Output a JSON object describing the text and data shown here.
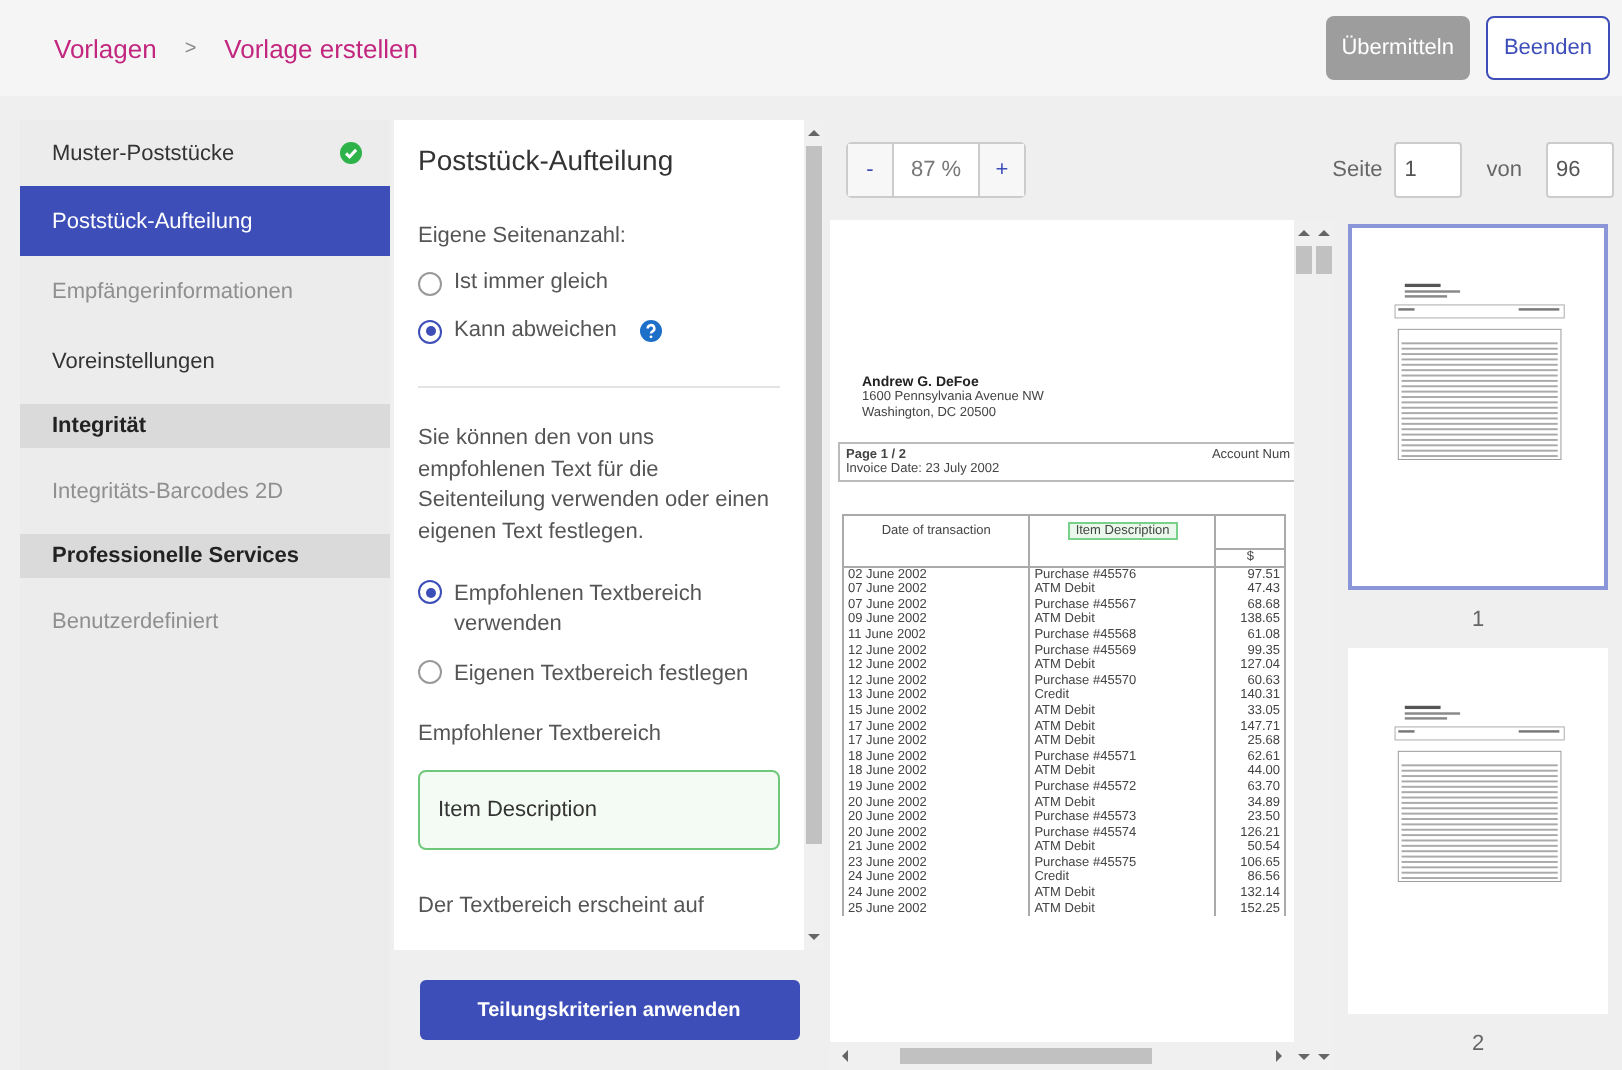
{
  "header": {
    "breadcrumb": [
      "Vorlagen",
      ">",
      "Vorlage erstellen"
    ],
    "buttons": [
      {
        "label": "Übermitteln",
        "kind": "primary",
        "disabled": true
      },
      {
        "label": "Beenden",
        "kind": "outline",
        "disabled": false
      }
    ]
  },
  "sidebar": {
    "items": [
      {
        "label": "Muster-Poststücke",
        "kind": "step",
        "selected": false,
        "disabled": false,
        "done": true
      },
      {
        "label": "Poststück-Aufteilung",
        "kind": "step",
        "selected": true,
        "disabled": false,
        "done": false
      },
      {
        "label": "Empfängerinformationen",
        "kind": "step",
        "selected": false,
        "disabled": true,
        "done": false
      },
      {
        "label": "Voreinstellungen",
        "kind": "step",
        "selected": false,
        "disabled": false,
        "done": false
      },
      {
        "label": "Integrität",
        "kind": "section"
      },
      {
        "label": "Integritäts-Barcodes 2D",
        "kind": "step",
        "selected": false,
        "disabled": true,
        "done": false
      },
      {
        "label": "Professionelle Services",
        "kind": "section"
      },
      {
        "label": "Benutzerdefiniert",
        "kind": "step",
        "selected": false,
        "disabled": true,
        "done": false
      }
    ]
  },
  "settings": {
    "title": "Poststück-Aufteilung",
    "page_count": {
      "label": "Eigene Seitenanzahl:",
      "options": [
        {
          "label": "Ist immer gleich",
          "selected": false,
          "help": false
        },
        {
          "label": "Kann abweichen",
          "selected": true,
          "help": true
        }
      ]
    },
    "description": "Sie können den von uns empfohlenen Text für die Seitenteilung verwenden oder einen eigenen Text festlegen.",
    "text_area": {
      "options": [
        {
          "label": "Empfohlenen Textbereich verwenden",
          "selected": true
        },
        {
          "label": "Eigenen Textbereich festlegen",
          "selected": false
        }
      ]
    },
    "recommended": {
      "label": "Empfohlener Textbereich",
      "value": "Item Description"
    },
    "note": "Der Textbereich erscheint auf",
    "apply_button": "Teilungskriterien anwenden"
  },
  "preview": {
    "zoom": {
      "minus": "-",
      "value": "87 %",
      "plus": "+"
    },
    "document": {
      "name": "Andrew G. DeFoe",
      "address": [
        "1600 Pennsylvania Avenue NW",
        "Washington, DC 20500"
      ],
      "page": "Page 1 / 2",
      "invoice_date": "Invoice Date: 23 July 2002",
      "account": "Account Num",
      "columns": [
        "Date of transaction",
        "Item Description"
      ],
      "subcolumn": "$",
      "rows": [
        [
          "02 June 2002",
          "Purchase #45576",
          "97.51"
        ],
        [
          "07 June 2002",
          "ATM Debit",
          "47.43"
        ],
        [
          "07 June 2002",
          "Purchase #45567",
          "68.68"
        ],
        [
          "09 June 2002",
          "ATM Debit",
          "138.65"
        ],
        [
          "11 June 2002",
          "Purchase #45568",
          "61.08"
        ],
        [
          "12 June 2002",
          "Purchase #45569",
          "99.35"
        ],
        [
          "12 June 2002",
          "ATM Debit",
          "127.04"
        ],
        [
          "12 June 2002",
          "Purchase #45570",
          "60.63"
        ],
        [
          "13 June 2002",
          "Credit",
          "140.31"
        ],
        [
          "15 June 2002",
          "ATM Debit",
          "33.05"
        ],
        [
          "17 June 2002",
          "ATM Debit",
          "147.71"
        ],
        [
          "17 June 2002",
          "ATM Debit",
          "25.68"
        ],
        [
          "18 June 2002",
          "Purchase #45571",
          "62.61"
        ],
        [
          "18 June 2002",
          "ATM Debit",
          "44.00"
        ],
        [
          "19 June 2002",
          "Purchase #45572",
          "63.70"
        ],
        [
          "20 June 2002",
          "ATM Debit",
          "34.89"
        ],
        [
          "20 June 2002",
          "Purchase #45573",
          "23.50"
        ],
        [
          "20 June 2002",
          "Purchase #45574",
          "126.21"
        ],
        [
          "21 June 2002",
          "ATM Debit",
          "50.54"
        ],
        [
          "23 June 2002",
          "Purchase #45575",
          "106.65"
        ],
        [
          "24 June 2002",
          "Credit",
          "86.56"
        ],
        [
          "24 June 2002",
          "ATM Debit",
          "132.14"
        ],
        [
          "25 June 2002",
          "ATM Debit",
          "152.25"
        ]
      ]
    }
  },
  "pager": {
    "page_label": "Seite",
    "page": "1",
    "of_label": "von",
    "total": "96",
    "thumbnails": [
      {
        "label": "1",
        "selected": true
      },
      {
        "label": "2",
        "selected": false
      }
    ]
  }
}
